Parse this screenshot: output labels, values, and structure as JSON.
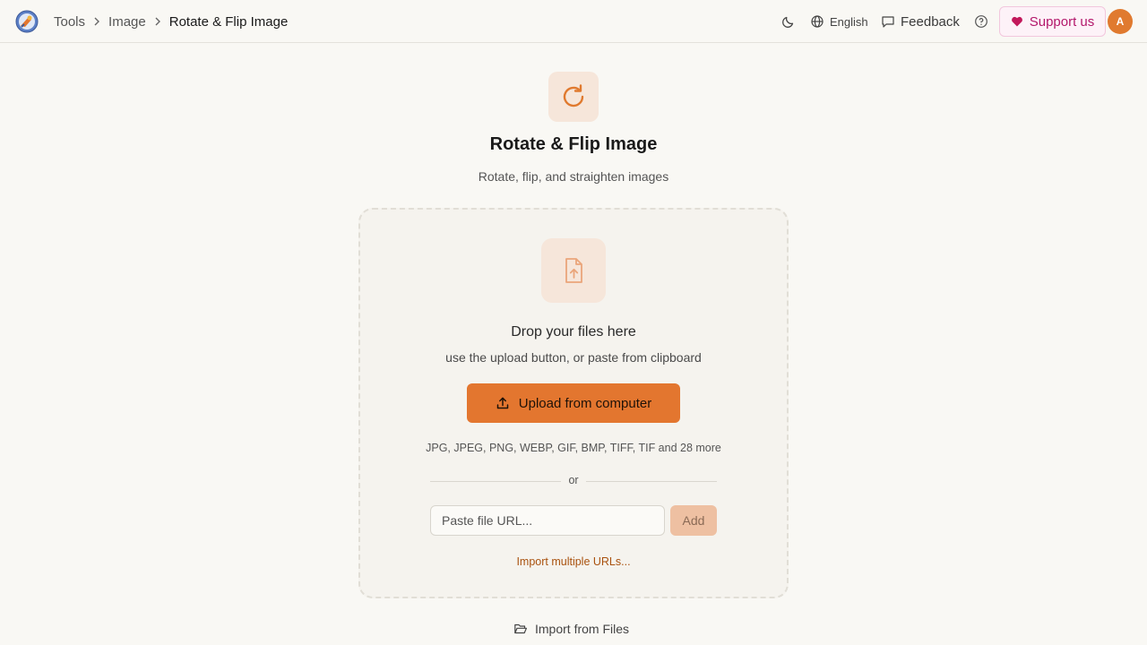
{
  "header": {
    "breadcrumb": [
      "Tools",
      "Image",
      "Rotate & Flip Image"
    ],
    "language": "English",
    "feedback": "Feedback",
    "support": "Support us",
    "avatar_initial": "A"
  },
  "hero": {
    "icon": "rotate-cw-icon",
    "title": "Rotate & Flip Image",
    "subtitle": "Rotate, flip, and straighten images"
  },
  "dropzone": {
    "icon": "file-upload-icon",
    "title": "Drop your files here",
    "subtitle": "use the upload button, or paste from clipboard",
    "upload_label": "Upload from computer",
    "formats": "JPG, JPEG, PNG, WEBP, GIF, BMP, TIFF, TIF and 28 more",
    "divider": "or",
    "url_placeholder": "Paste file URL...",
    "add_label": "Add",
    "import_multiple": "Import multiple URLs..."
  },
  "footer": {
    "import_files": "Import from Files"
  },
  "colors": {
    "accent": "#e3762f",
    "support_text": "#b3176b",
    "background": "#f9f8f4"
  }
}
